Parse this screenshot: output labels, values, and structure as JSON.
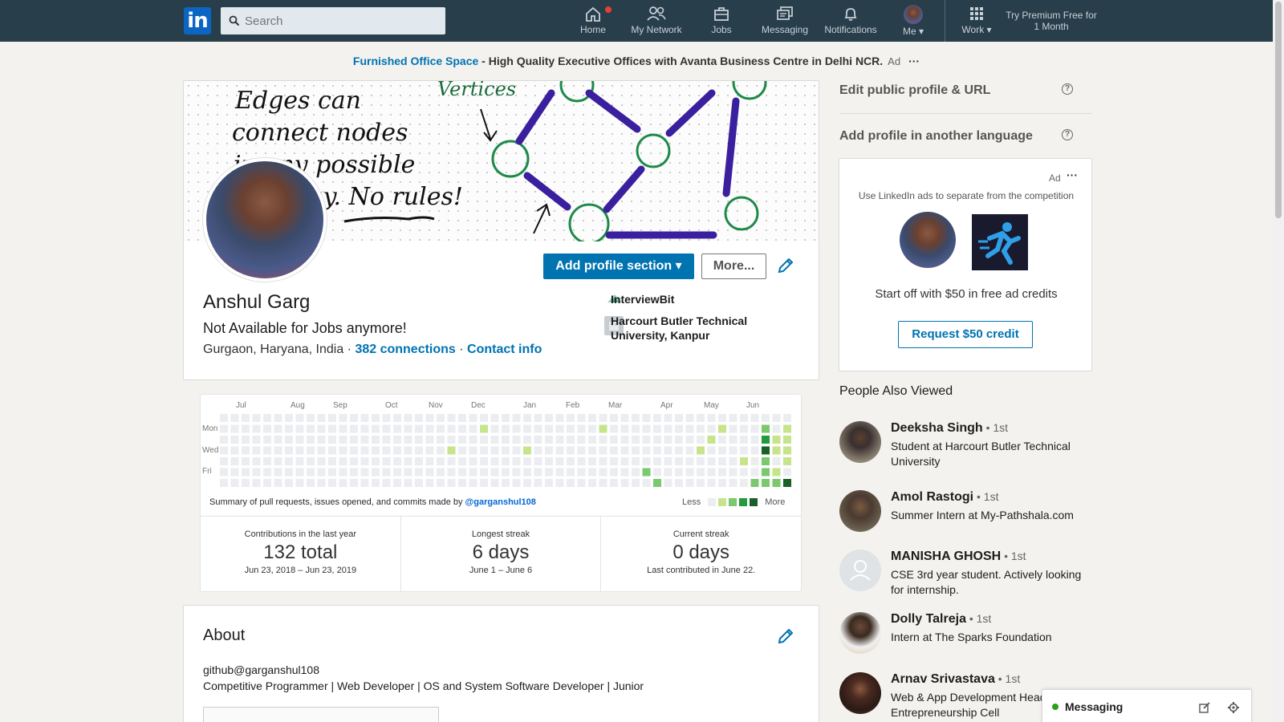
{
  "nav": {
    "logo": "in",
    "search_placeholder": "Search",
    "items": [
      {
        "label": "Home"
      },
      {
        "label": "My Network"
      },
      {
        "label": "Jobs"
      },
      {
        "label": "Messaging"
      },
      {
        "label": "Notifications"
      },
      {
        "label": "Me"
      },
      {
        "label": "Work"
      }
    ],
    "premium": "Try Premium Free for 1 Month"
  },
  "ad_banner": {
    "link": "Furnished Office Space",
    "sep": " - ",
    "text": "High Quality Executive Offices with Avanta Business Centre in Delhi NCR.",
    "ad": "Ad",
    "menu": "···"
  },
  "cover": {
    "text_lines": [
      "Edges can",
      "connect nodes",
      "in any possible",
      "way. No rules!"
    ],
    "vertices_label": "Vertices"
  },
  "profile": {
    "add_section": "Add profile section",
    "more": "More...",
    "name": "Anshul Garg",
    "headline": "Not Available for Jobs anymore!",
    "location": "Gurgaon, Haryana, India",
    "dot": " · ",
    "connections": "382 connections",
    "contact": "Contact info",
    "company": "InterviewBit",
    "school": "Harcourt Butler Technical University, Kanpur"
  },
  "github": {
    "months": [
      "Jul",
      "Aug",
      "Sep",
      "Oct",
      "Nov",
      "Dec",
      "Jan",
      "Feb",
      "Mar",
      "Apr",
      "May",
      "Jun"
    ],
    "days": [
      "Mon",
      "Wed",
      "Fri"
    ],
    "summary_prefix": "Summary of pull requests, issues opened, and commits made by ",
    "handle": "@garganshul108",
    "less": "Less",
    "more": "More",
    "stats": [
      {
        "title": "Contributions in the last year",
        "value": "132 total",
        "sub": "Jun 23, 2018 – Jun 23, 2019"
      },
      {
        "title": "Longest streak",
        "value": "6 days",
        "sub": "June 1 – June 6"
      },
      {
        "title": "Current streak",
        "value": "0 days",
        "sub": "Last contributed in June 22."
      }
    ],
    "colors": [
      "#ebedf0",
      "#c6e48b",
      "#7bc96f",
      "#239a3b",
      "#196127"
    ]
  },
  "about": {
    "title": "About",
    "line1": "github@garganshul108",
    "line2": "Competitive Programmer | Web Developer | OS and System Software Developer | Junior"
  },
  "sidebar": {
    "edit_public": "Edit public profile & URL",
    "add_language": "Add profile in another language",
    "ad": {
      "label": "Ad",
      "menu": "···",
      "tagline": "Use LinkedIn ads to separate from the competition",
      "offer": "Start off with $50 in free ad credits",
      "button": "Request $50 credit"
    },
    "pav_title": "People Also Viewed",
    "people": [
      {
        "name": "Deeksha Singh",
        "degree": " • 1st",
        "headline": "Student at Harcourt Butler Technical University"
      },
      {
        "name": "Amol Rastogi",
        "degree": " • 1st",
        "headline": "Summer Intern at My-Pathshala.com"
      },
      {
        "name": "MANISHA GHOSH",
        "degree": " • 1st",
        "headline": "CSE 3rd year student. Actively looking for internship."
      },
      {
        "name": "Dolly Talreja",
        "degree": " • 1st",
        "headline": "Intern at The Sparks Foundation"
      },
      {
        "name": "Arnav Srivastava",
        "degree": " • 1st",
        "headline": "Web & App Development Head, Entrepreneurship Cell"
      }
    ]
  },
  "messaging": {
    "label": "Messaging"
  },
  "colors": {
    "nav_bg": "#283e4a",
    "brand": "#0073b1",
    "logo": "#0a66c2",
    "badge": "#e34234"
  }
}
